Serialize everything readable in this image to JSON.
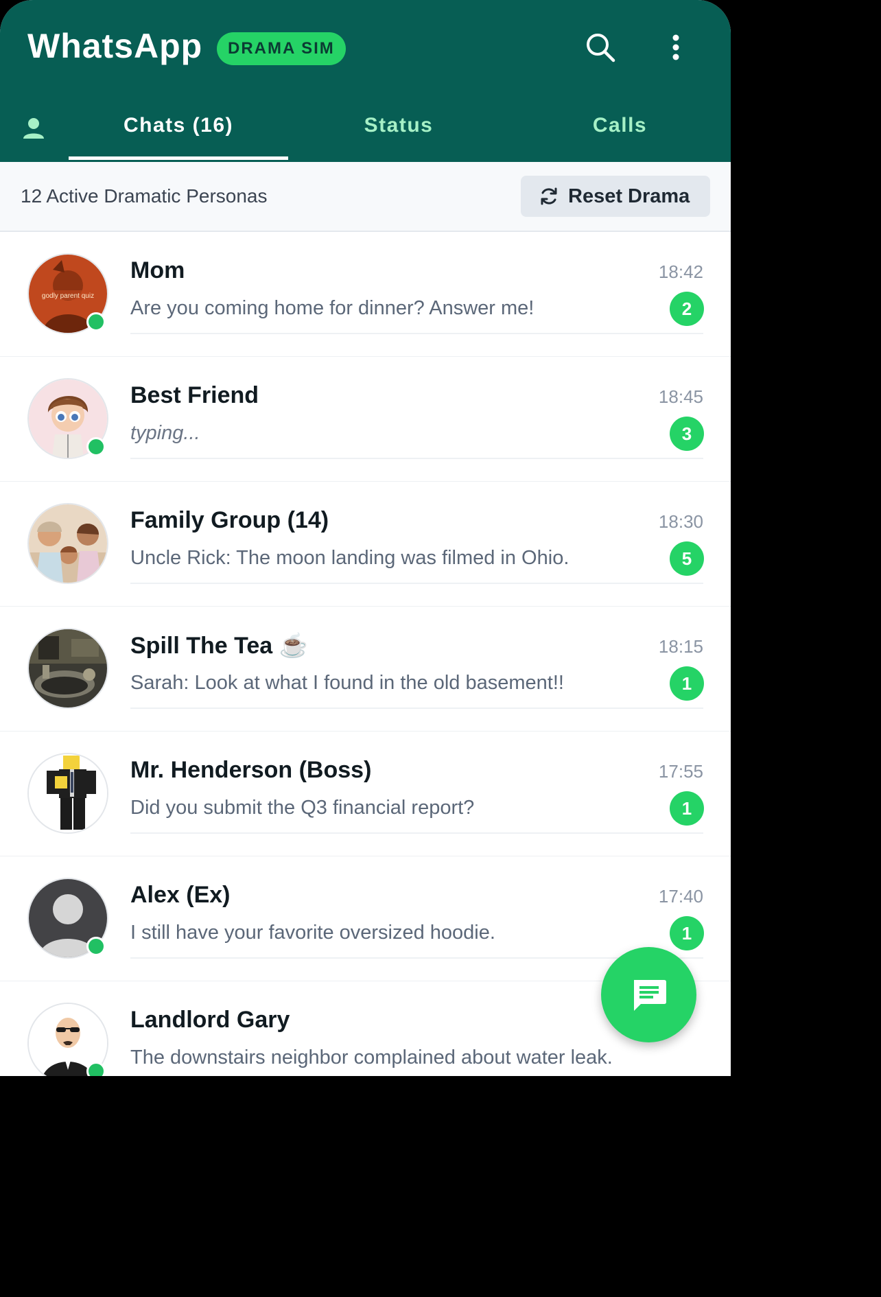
{
  "app": {
    "title": "WhatsApp",
    "badge": "DRAMA SIM",
    "colors": {
      "header": "#075e54",
      "accent": "#25d366",
      "online": "#21c063"
    }
  },
  "header": {
    "search_icon": "search-icon",
    "menu_icon": "more-vertical-icon"
  },
  "tabs": [
    {
      "label": "Chats (16)",
      "active": true
    },
    {
      "label": "Status",
      "active": false
    },
    {
      "label": "Calls",
      "active": false
    }
  ],
  "subbar": {
    "persona_count": "12 Active Dramatic Personas",
    "reset_label": "Reset Drama",
    "reset_icon": "refresh-icon"
  },
  "chats": [
    {
      "name": "Mom",
      "time": "18:42",
      "preview": "Are you coming home for dinner? Answer me!",
      "unread": "2",
      "online": true,
      "avatar_text": "godly parent quiz"
    },
    {
      "name": "Best Friend",
      "time": "18:45",
      "preview": "typing...",
      "unread": "3",
      "online": true
    },
    {
      "name": "Family Group (14)",
      "time": "18:30",
      "preview": "Uncle Rick: The moon landing was filmed in Ohio.",
      "unread": "5",
      "online": false
    },
    {
      "name": "Spill The Tea ☕",
      "time": "18:15",
      "preview": "Sarah: Look at what I found in the old basement!!",
      "unread": "1",
      "online": false
    },
    {
      "name": "Mr. Henderson (Boss)",
      "time": "17:55",
      "preview": "Did you submit the Q3 financial report?",
      "unread": "1",
      "online": false
    },
    {
      "name": "Alex (Ex)",
      "time": "17:40",
      "preview": "I still have your favorite oversized hoodie.",
      "unread": "1",
      "online": true
    },
    {
      "name": "Landlord Gary",
      "time": "",
      "preview": "The downstairs neighbor complained about water leak.",
      "unread": "",
      "online": true
    }
  ],
  "fab": {
    "icon": "new-chat-icon"
  }
}
